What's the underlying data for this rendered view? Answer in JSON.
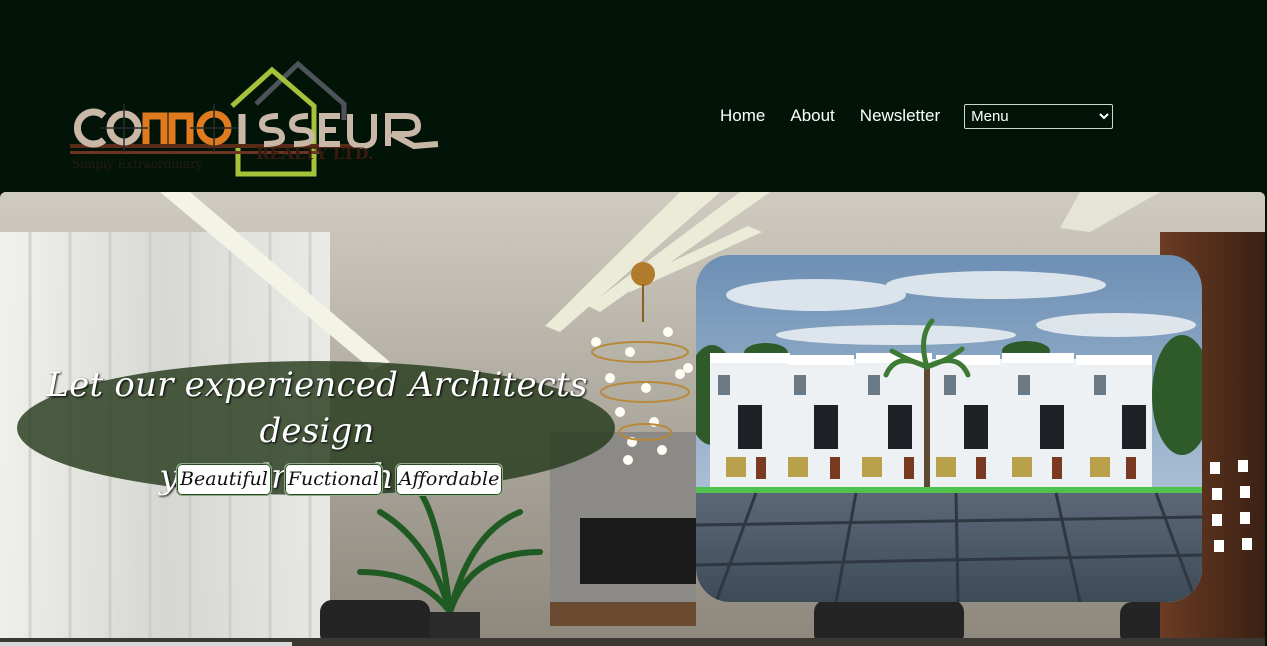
{
  "header": {
    "logo": {
      "brand_text": "CONNOISSEUR",
      "sub_text": "REALTY LTD.",
      "tagline": "Simply Extraordinary"
    },
    "nav": {
      "items": [
        "Home",
        "About",
        "Newsletter"
      ],
      "menu_select": {
        "selected": "Menu",
        "options": [
          "Menu"
        ]
      }
    }
  },
  "hero": {
    "headline_line1": "Let our experienced Architects design",
    "headline_line2": "your dream house",
    "tags": [
      "Beautiful",
      "Fuctional",
      "Affordable"
    ]
  },
  "colors": {
    "page_background": "#021408",
    "nav_text": "#ffffff",
    "headline_oval": "#263a1c",
    "logo_green": "#a6c13a",
    "logo_orange": "#e07a1f",
    "logo_grey": "#4d5358"
  }
}
